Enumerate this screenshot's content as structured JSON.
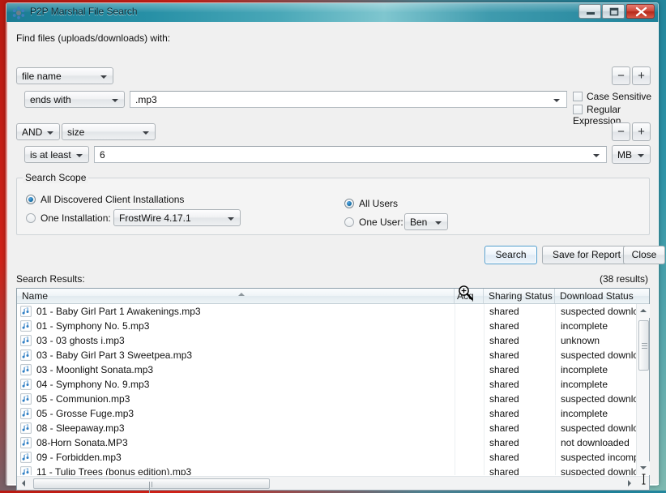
{
  "window": {
    "title": "P2P Marshal File Search",
    "app_icon": "network-nodes-icon",
    "controls": {
      "minimize": "minimize-icon",
      "maximize": "maximize-icon",
      "close": "close-icon"
    }
  },
  "form": {
    "find_label": "Find files (uploads/downloads) with:",
    "criteria": [
      {
        "field_select": "file name",
        "operator_select": "ends with",
        "value": ".mp3",
        "remove_label": "−",
        "add_label": "+"
      },
      {
        "conjunction_select": "AND",
        "field_select": "size",
        "operator_select": "is at least",
        "value": "6",
        "unit_select": "MB",
        "remove_label": "−",
        "add_label": "+"
      }
    ],
    "options": {
      "case_sensitive": "Case Sensitive",
      "regular_expression": "Regular Expression",
      "case_sensitive_checked": false,
      "regular_expression_checked": false
    }
  },
  "scope": {
    "legend": "Search Scope",
    "all_installations": "All Discovered Client Installations",
    "one_installation": "One Installation:",
    "installation_value": "FrostWire 4.17.1",
    "installation_mode": "all",
    "all_users": "All Users",
    "one_user": "One User:",
    "user_value": "Ben",
    "user_mode": "all"
  },
  "actions": {
    "search": "Search",
    "save_for_report": "Save for Report",
    "close": "Close"
  },
  "results": {
    "label": "Search Results:",
    "count": "(38 results)",
    "columns": [
      "Name",
      "Acq",
      "Sharing Status",
      "Download Status"
    ],
    "sort_column": "Name",
    "sort_direction": "ascending",
    "rows": [
      {
        "name": "01 - Baby Girl Part 1 Awakenings.mp3",
        "acq": "",
        "sharing": "shared",
        "download": "suspected downloaded"
      },
      {
        "name": "01 - Symphony No. 5.mp3",
        "acq": "",
        "sharing": "shared",
        "download": "incomplete"
      },
      {
        "name": "03 - 03 ghosts i.mp3",
        "acq": "",
        "sharing": "shared",
        "download": "unknown"
      },
      {
        "name": "03 - Baby Girl Part 3 Sweetpea.mp3",
        "acq": "",
        "sharing": "shared",
        "download": "suspected downloaded"
      },
      {
        "name": "03 - Moonlight Sonata.mp3",
        "acq": "",
        "sharing": "shared",
        "download": "incomplete"
      },
      {
        "name": "04 - Symphony No. 9.mp3",
        "acq": "",
        "sharing": "shared",
        "download": "incomplete"
      },
      {
        "name": "05 - Communion.mp3",
        "acq": "",
        "sharing": "shared",
        "download": "suspected downloaded"
      },
      {
        "name": "05 - Grosse Fuge.mp3",
        "acq": "",
        "sharing": "shared",
        "download": "incomplete"
      },
      {
        "name": "08 - Sleepaway.mp3",
        "acq": "",
        "sharing": "shared",
        "download": "suspected downloaded"
      },
      {
        "name": "08-Horn Sonata.MP3",
        "acq": "",
        "sharing": "shared",
        "download": "not downloaded"
      },
      {
        "name": "09 - Forbidden.mp3",
        "acq": "",
        "sharing": "shared",
        "download": "suspected incomplete"
      },
      {
        "name": "11 - Tulip Trees (bonus edition).mp3",
        "acq": "",
        "sharing": "shared",
        "download": "suspected downloaded"
      }
    ],
    "row_icon": "music-note-icon"
  },
  "colors": {
    "titlebar_teal": "#2790a6",
    "desktop_red": "#cf2218",
    "default_button_border": "#4f9ccd",
    "radio_dot": "#11699f",
    "file_icon_blue": "#2f7fc4"
  }
}
